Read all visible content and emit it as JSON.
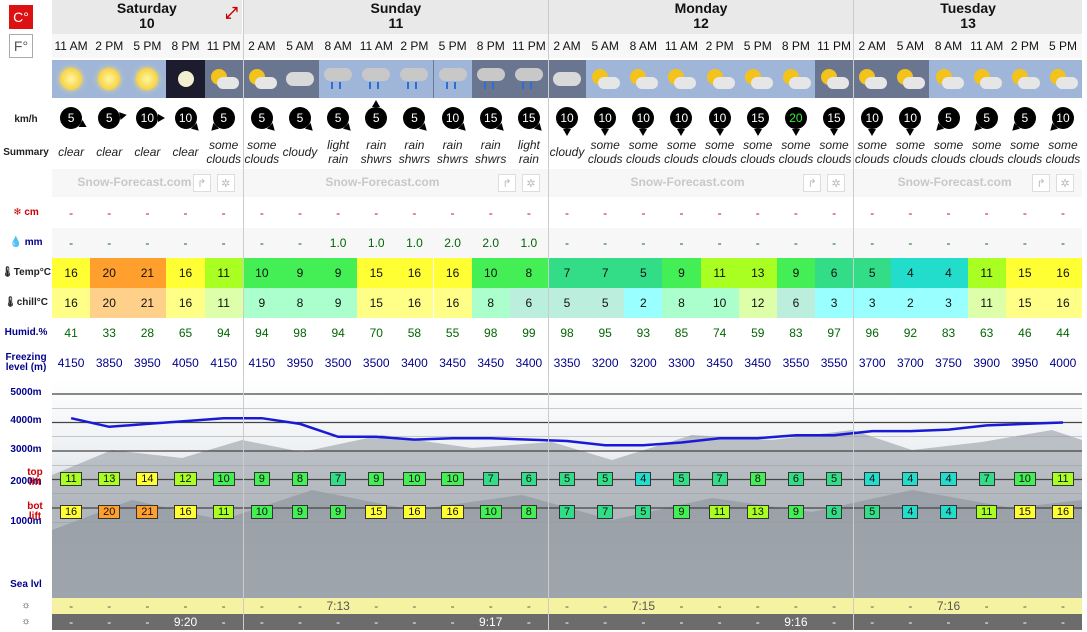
{
  "units": {
    "celsius": "C°",
    "fahrenheit": "F°"
  },
  "days": [
    {
      "name": "Saturday",
      "num": "10",
      "cols": 5
    },
    {
      "name": "Sunday",
      "num": "11",
      "cols": 8
    },
    {
      "name": "Monday",
      "num": "12",
      "cols": 8
    },
    {
      "name": "Tuesday",
      "num": "13",
      "cols": 6
    }
  ],
  "hours": [
    "11 AM",
    "2 PM",
    "5 PM",
    "8 PM",
    "11 PM",
    "2 AM",
    "5 AM",
    "8 AM",
    "11 AM",
    "2 PM",
    "5 PM",
    "8 PM",
    "11 PM",
    "2 AM",
    "5 AM",
    "8 AM",
    "11 AM",
    "2 PM",
    "5 PM",
    "8 PM",
    "11 PM",
    "2 AM",
    "5 AM",
    "8 AM",
    "11 AM",
    "2 PM",
    "5 PM"
  ],
  "icons": [
    "sun",
    "sun",
    "sun",
    "moon",
    "cloud-sun",
    "cloud-sun",
    "cloud",
    "rain-cloud",
    "rain-cloud",
    "rain-cloud",
    "rain-cloud",
    "rain-cloud",
    "rain-cloud",
    "cloud",
    "cloud-sun",
    "cloud-sun",
    "cloud-sun",
    "cloud-sun",
    "cloud-sun",
    "cloud-sun",
    "cloud-sun",
    "cloud-sun",
    "cloud-sun",
    "cloud-sun",
    "cloud-sun",
    "cloud-sun",
    "cloud-sun"
  ],
  "labels": {
    "wind": "km/h",
    "summary": "Summary",
    "snow": "cm",
    "rain": "mm",
    "temp": "Temp°C",
    "chill": "chill°C",
    "humid": "Humid.%",
    "freezing": "Freezing level (m)",
    "top_lift": "top lift",
    "bot_lift": "bot lift",
    "sea_level": "Sea lvl",
    "axis": [
      "5000m",
      "4000m",
      "3000m",
      "2000m",
      "1000m"
    ]
  },
  "watermark": "Snow-Forecast.com",
  "wind": [
    5,
    5,
    10,
    10,
    5,
    5,
    5,
    5,
    5,
    5,
    10,
    15,
    15,
    10,
    10,
    10,
    10,
    10,
    15,
    20,
    15,
    10,
    10,
    5,
    5,
    5,
    10
  ],
  "wind_dir": [
    120,
    80,
    90,
    135,
    225,
    135,
    135,
    135,
    0,
    135,
    135,
    135,
    135,
    180,
    180,
    180,
    180,
    180,
    180,
    180,
    180,
    180,
    180,
    225,
    225,
    225,
    225
  ],
  "summary": [
    "clear",
    "clear",
    "clear",
    "clear",
    "some clouds",
    "some clouds",
    "cloudy",
    "light rain",
    "rain shwrs",
    "rain shwrs",
    "rain shwrs",
    "rain shwrs",
    "light rain",
    "cloudy",
    "some clouds",
    "some clouds",
    "some clouds",
    "some clouds",
    "some clouds",
    "some clouds",
    "some clouds",
    "some clouds",
    "some clouds",
    "some clouds",
    "some clouds",
    "some clouds",
    "some clouds"
  ],
  "snow": [
    "-",
    "-",
    "-",
    "-",
    "-",
    "-",
    "-",
    "-",
    "-",
    "-",
    "-",
    "-",
    "-",
    "-",
    "-",
    "-",
    "-",
    "-",
    "-",
    "-",
    "-",
    "-",
    "-",
    "-",
    "-",
    "-",
    "-"
  ],
  "rain": [
    "-",
    "-",
    "-",
    "-",
    "-",
    "-",
    "-",
    "1.0",
    "1.0",
    "1.0",
    "2.0",
    "2.0",
    "1.0",
    "-",
    "-",
    "-",
    "-",
    "-",
    "-",
    "-",
    "-",
    "-",
    "-",
    "-",
    "-",
    "-",
    "-"
  ],
  "temp": [
    16,
    20,
    21,
    16,
    11,
    10,
    9,
    9,
    15,
    16,
    16,
    10,
    8,
    7,
    7,
    5,
    9,
    11,
    13,
    9,
    6,
    5,
    4,
    4,
    11,
    15,
    16
  ],
  "chill": [
    16,
    20,
    21,
    16,
    11,
    9,
    8,
    9,
    15,
    16,
    16,
    8,
    6,
    5,
    5,
    2,
    8,
    10,
    12,
    6,
    3,
    3,
    2,
    3,
    11,
    15,
    16
  ],
  "humid": [
    41,
    33,
    28,
    65,
    94,
    94,
    98,
    94,
    70,
    58,
    55,
    98,
    99,
    98,
    95,
    93,
    85,
    74,
    59,
    83,
    97,
    96,
    92,
    83,
    63,
    46,
    44
  ],
  "freezing": [
    4150,
    3850,
    3950,
    4050,
    4150,
    4150,
    3950,
    3500,
    3500,
    3400,
    3450,
    3450,
    3400,
    3350,
    3200,
    3200,
    3300,
    3450,
    3450,
    3550,
    3550,
    3700,
    3700,
    3750,
    3900,
    3950,
    4000
  ],
  "top_lift": [
    11,
    13,
    14,
    12,
    10,
    9,
    8,
    7,
    9,
    10,
    10,
    7,
    6,
    5,
    5,
    4,
    5,
    7,
    8,
    6,
    5,
    4,
    4,
    4,
    7,
    10,
    11
  ],
  "bot_lift": [
    16,
    20,
    21,
    16,
    11,
    10,
    9,
    9,
    15,
    16,
    16,
    10,
    8,
    7,
    7,
    5,
    9,
    11,
    13,
    9,
    6,
    5,
    4,
    4,
    11,
    15,
    16
  ],
  "sunrise": [
    "-",
    "-",
    "-",
    "-",
    "-",
    "-",
    "-",
    "7:13",
    "-",
    "-",
    "-",
    "-",
    "-",
    "-",
    "-",
    "7:15",
    "-",
    "-",
    "-",
    "-",
    "-",
    "-",
    "-",
    "7:16",
    "-",
    "-",
    "-"
  ],
  "sunset": [
    "-",
    "-",
    "-",
    "9:20",
    "-",
    "-",
    "-",
    "-",
    "-",
    "-",
    "-",
    "9:17",
    "-",
    "-",
    "-",
    "-",
    "-",
    "-",
    "-",
    "9:16",
    "-",
    "-",
    "-",
    "-",
    "-",
    "-",
    "-"
  ]
}
